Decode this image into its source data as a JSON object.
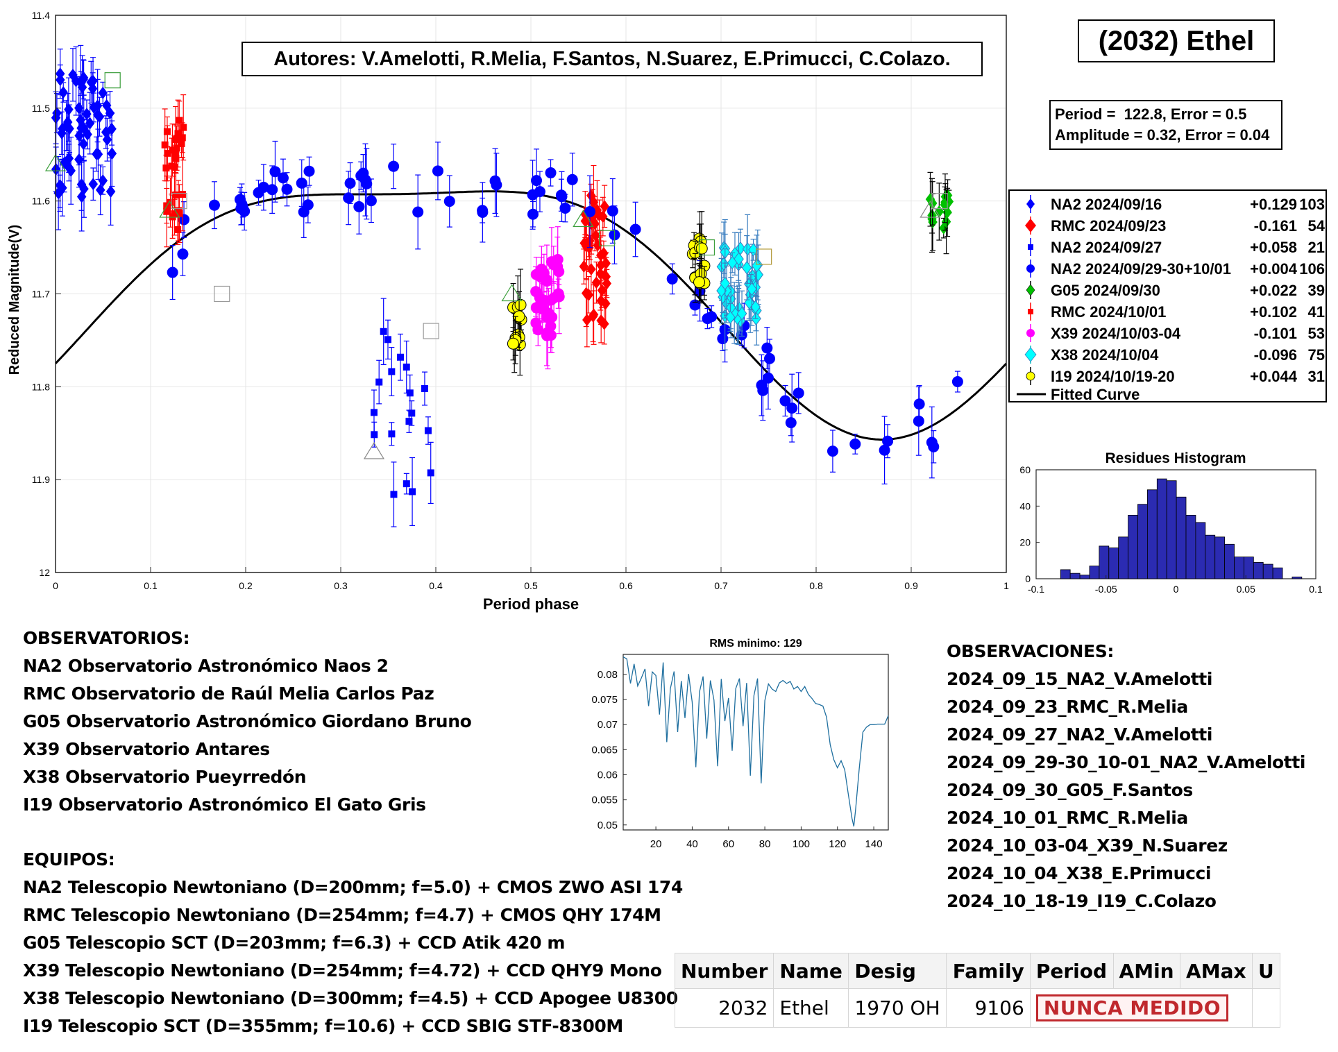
{
  "main_plot": {
    "ylabel": "Reduced Magnitude(V)",
    "xlabel": "Period phase",
    "x_ticks": [
      "0",
      "0.1",
      "0.2",
      "0.3",
      "0.4",
      "0.5",
      "0.6",
      "0.7",
      "0.8",
      "0.9",
      "1"
    ],
    "y_ticks": [
      "11.4",
      "11.5",
      "11.6",
      "11.7",
      "11.8",
      "11.9",
      "12"
    ]
  },
  "chart_data": [
    {
      "type": "scatter",
      "xlabel": "Period phase",
      "ylabel": "Reduced Magnitude(V)",
      "xlim": [
        0,
        1
      ],
      "ylim": [
        12,
        11.4
      ],
      "y_inverted": true,
      "grid": true,
      "legend_placement": "right",
      "fitted_curve": {
        "name": "Fitted Curve",
        "period": 122.8,
        "mean": 11.687,
        "harmonics": [
          {
            "n": 1,
            "cos": 0.0915,
            "sin": -0.0955
          },
          {
            "n": 2,
            "cos": -0.0035,
            "sin": -0.0375
          }
        ]
      },
      "series": [
        {
          "name": "NA2 2024/09/16",
          "offset": "+0.129",
          "count": "103",
          "marker": "diamond",
          "color": "#0000ff",
          "x_range": [
            0.0,
            0.06
          ],
          "y_range": [
            11.46,
            11.6
          ]
        },
        {
          "name": "RMC 2024/09/23",
          "offset": "-0.161",
          "count": "54",
          "marker": "diamond",
          "color": "#ff0000",
          "x_range": [
            0.555,
            0.58
          ],
          "y_range": [
            11.59,
            11.74
          ]
        },
        {
          "name": "NA2 2024/09/27",
          "offset": "+0.058",
          "count": "21",
          "marker": "square",
          "color": "#0000ff",
          "x_range": [
            0.335,
            0.395
          ],
          "y_range": [
            11.74,
            11.92
          ]
        },
        {
          "name": "NA2 2024/09/29-30+10/01",
          "offset": "+0.004",
          "count": "106",
          "marker": "circle",
          "color": "#0000ff",
          "x_range": [
            0.12,
            0.95
          ],
          "y_range": [
            11.52,
            11.74
          ]
        },
        {
          "name": "G05 2024/09/30",
          "offset": "+0.022",
          "count": "39",
          "marker": "diamond",
          "color": "#00c000",
          "x_range": [
            0.92,
            0.94
          ],
          "y_range": [
            11.59,
            11.63
          ]
        },
        {
          "name": "RMC 2024/10/01",
          "offset": "+0.102",
          "count": "41",
          "marker": "square",
          "color": "#ff0000",
          "x_range": [
            0.115,
            0.135
          ],
          "y_range": [
            11.51,
            11.64
          ]
        },
        {
          "name": "X39 2024/10/03-04",
          "offset": "-0.101",
          "count": "53",
          "marker": "circle",
          "color": "#ff00ff",
          "x_range": [
            0.505,
            0.53
          ],
          "y_range": [
            11.66,
            11.75
          ]
        },
        {
          "name": "X38 2024/10/04",
          "offset": "-0.096",
          "count": "75",
          "marker": "diamond",
          "color": "#00ffff",
          "x_range": [
            0.7,
            0.74
          ],
          "y_range": [
            11.65,
            11.73
          ]
        },
        {
          "name": "I19 2024/10/19-20",
          "offset": "+0.044",
          "count": "31",
          "marker": "circle",
          "color": "#ffff00",
          "x_range": [
            0.48,
            0.49
          ],
          "y_range": [
            11.7,
            11.76
          ]
        },
        {
          "name": "I19 2024/10/19-20 (second group)",
          "marker": "circle",
          "color": "#ffff00",
          "x_range": [
            0.67,
            0.685
          ],
          "y_range": [
            11.64,
            11.69
          ]
        }
      ]
    },
    {
      "type": "bar",
      "title": "Residues Histogram",
      "xlim": [
        -0.1,
        0.1
      ],
      "ylim": [
        0,
        60
      ],
      "x_ticks": [
        "-0.1",
        "-0.05",
        "0",
        "0.05",
        "0.1"
      ],
      "y_ticks": [
        "0",
        "20",
        "40",
        "60"
      ],
      "bin_width": 0.0069,
      "bin_starts": [
        -0.0825,
        -0.0756,
        -0.0687,
        -0.0618,
        -0.0549,
        -0.048,
        -0.0411,
        -0.0342,
        -0.0273,
        -0.0204,
        -0.0135,
        -0.0066,
        0.0003,
        0.0072,
        0.0141,
        0.021,
        0.0279,
        0.0348,
        0.0417,
        0.0486,
        0.0555,
        0.0624,
        0.0693,
        0.0762,
        0.0831
      ],
      "values": [
        5,
        3,
        2,
        7,
        18,
        17,
        23,
        35,
        41,
        49,
        55,
        54,
        45,
        35,
        31,
        24,
        23,
        19,
        12,
        12,
        9,
        8,
        6,
        0,
        1
      ],
      "color": "#2b2bb2"
    },
    {
      "type": "line",
      "title": "RMS minimo: 129",
      "xlim": [
        2,
        148
      ],
      "ylim": [
        0.049,
        0.084
      ],
      "x_ticks": [
        "20",
        "40",
        "60",
        "80",
        "100",
        "120",
        "140"
      ],
      "y_ticks": [
        "0.08",
        "0.075",
        "0.07",
        "0.065",
        "0.06",
        "0.055",
        "0.05"
      ],
      "x": [
        2,
        4,
        6,
        8,
        10,
        12,
        14,
        16,
        18,
        20,
        22,
        24,
        26,
        28,
        30,
        32,
        34,
        36,
        38,
        40,
        42,
        44,
        46,
        48,
        50,
        52,
        54,
        56,
        58,
        60,
        62,
        64,
        66,
        68,
        70,
        72,
        74,
        76,
        78,
        80,
        82,
        84,
        86,
        88,
        90,
        92,
        94,
        96,
        98,
        100,
        102,
        104,
        106,
        108,
        110,
        112,
        114,
        116,
        118,
        120,
        122,
        124,
        126,
        128,
        129,
        130,
        132,
        134,
        136,
        138,
        140,
        142,
        144,
        146,
        148
      ],
      "values": [
        0.0835,
        0.0831,
        0.0782,
        0.0821,
        0.0777,
        0.0793,
        0.0811,
        0.0737,
        0.0805,
        0.0798,
        0.072,
        0.0824,
        0.0665,
        0.0772,
        0.0806,
        0.0685,
        0.0787,
        0.0713,
        0.0801,
        0.0745,
        0.0615,
        0.0765,
        0.0796,
        0.0672,
        0.0788,
        0.0749,
        0.0617,
        0.0791,
        0.0707,
        0.0753,
        0.0648,
        0.0772,
        0.0792,
        0.0697,
        0.0783,
        0.0598,
        0.0758,
        0.0792,
        0.0583,
        0.0748,
        0.0781,
        0.0771,
        0.0766,
        0.0783,
        0.0788,
        0.0782,
        0.0786,
        0.0771,
        0.0776,
        0.0766,
        0.0776,
        0.076,
        0.0752,
        0.0742,
        0.074,
        0.0737,
        0.0715,
        0.066,
        0.063,
        0.0614,
        0.0628,
        0.061,
        0.0561,
        0.0513,
        0.0497,
        0.0531,
        0.0612,
        0.0685,
        0.0695,
        0.07,
        0.07,
        0.0701,
        0.0701,
        0.0701,
        0.0718
      ],
      "color": "#1f6f9f"
    }
  ],
  "authors": "Autores: V.Amelotti, R.Melia, F.Santos, N.Suarez, E.Primucci, C.Colazo.",
  "object_name": "(2032) Ethel",
  "period_box": {
    "line1": "Period =  122.8, Error = 0.5",
    "line2": "Amplitude = 0.32, Error = 0.04"
  },
  "legend": {
    "items": [
      {
        "label": "NA2 2024/09/16",
        "offset": "+0.129",
        "count": "103"
      },
      {
        "label": "RMC 2024/09/23",
        "offset": "-0.161",
        "count": "54"
      },
      {
        "label": "NA2 2024/09/27",
        "offset": "+0.058",
        "count": "21"
      },
      {
        "label": "NA2 2024/09/29-30+10/01",
        "offset": "+0.004",
        "count": "106"
      },
      {
        "label": "G05 2024/09/30",
        "offset": "+0.022",
        "count": "39"
      },
      {
        "label": "RMC 2024/10/01",
        "offset": "+0.102",
        "count": "41"
      },
      {
        "label": "X39 2024/10/03-04",
        "offset": "-0.101",
        "count": "53"
      },
      {
        "label": "X38 2024/10/04",
        "offset": "-0.096",
        "count": "75"
      },
      {
        "label": "I19 2024/10/19-20",
        "offset": "+0.044",
        "count": "31"
      }
    ],
    "fitted_label": "Fitted Curve"
  },
  "histogram": {
    "title": "Residues Histogram"
  },
  "rms": {
    "title": "RMS minimo: 129"
  },
  "observatorios": {
    "heading": "OBSERVATORIOS:",
    "lines": [
      "NA2 Observatorio Astronómico Naos 2",
      "RMC Observatorio de Raúl Melia Carlos Paz",
      "G05 Observatorio Astronómico Giordano Bruno",
      "X39 Observatorio Antares",
      "X38 Observatorio Pueyrredón",
      "I19 Observatorio Astronómico El Gato Gris"
    ]
  },
  "equipos": {
    "heading": "EQUIPOS:",
    "lines": [
      "NA2 Telescopio Newtoniano (D=200mm; f=5.0) + CMOS ZWO ASI 174",
      "RMC Telescopio Newtoniano (D=254mm; f=4.7) + CMOS QHY 174M",
      "G05 Telescopio SCT (D=203mm; f=6.3) + CCD Atik 420 m",
      "X39 Telescopio Newtoniano (D=254mm; f=4.72) + CCD QHY9 Mono",
      "X38 Telescopio Newtoniano (D=300mm; f=4.5) + CCD Apogee U8300",
      "I19 Telescopio SCT (D=355mm; f=10.6) + CCD SBIG STF-8300M"
    ]
  },
  "observaciones": {
    "heading": "OBSERVACIONES:",
    "lines": [
      "2024_09_15_NA2_V.Amelotti",
      "2024_09_23_RMC_R.Melia",
      "2024_09_27_NA2_V.Amelotti",
      "2024_09_29-30_10-01_NA2_V.Amelotti",
      "2024_09_30_G05_F.Santos",
      "2024_10_01_RMC_R.Melia",
      "2024_10_03-04_X39_N.Suarez",
      "2024_10_04_X38_E.Primucci",
      "2024_10_18-19_I19_C.Colazo"
    ]
  },
  "mpc_table": {
    "headers": [
      "Number",
      "Name",
      "Desig",
      "Family",
      "Period",
      "AMin",
      "AMax",
      "U"
    ],
    "row": {
      "number": "2032",
      "name": "Ethel",
      "desig": "1970 OH",
      "family": "9106",
      "period": "NUNCA MEDIDO",
      "amin": "",
      "amax": "",
      "u": ""
    }
  }
}
